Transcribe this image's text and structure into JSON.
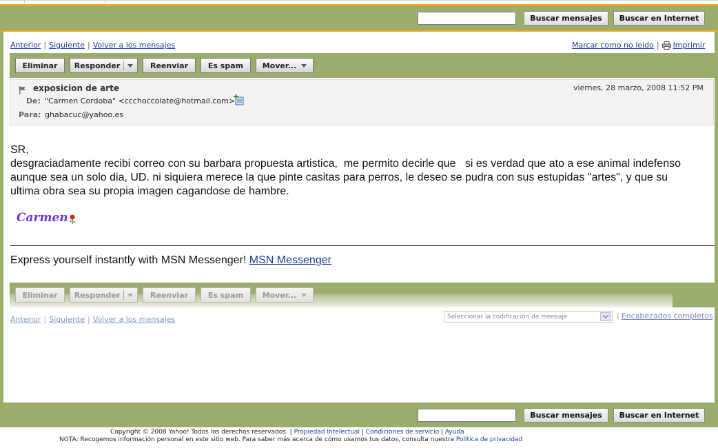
{
  "top_search": {
    "search_messages": "Buscar mensajes",
    "search_web": "Buscar en Internet"
  },
  "nav": {
    "prev": "Anterior",
    "next": "Siguiente",
    "back": "Volver a los mensajes",
    "mark_unread": "Marcar como no leído",
    "print": "Imprimir"
  },
  "toolbar": {
    "delete": "Eliminar",
    "reply": "Responder",
    "forward": "Reenviar",
    "spam": "Es spam",
    "move": "Mover..."
  },
  "message": {
    "subject": "exposicion de arte",
    "date": "viernes, 28 marzo, 2008 11:52 PM",
    "from_label": "De:",
    "from_value": "\"Carmen Cordoba\" <ccchoccolate@hotmail.com>",
    "to_label": "Para:",
    "to_value": "ghabacuc@yahoo.es",
    "greeting": "SR,",
    "line1": "desgraciadamente recibi correo con su barbara propuesta artistica,  me permito decirle que   si es verdad que ato a ese animal indefenso",
    "line2": "aunque sea un solo dia, UD. ni siquiera merece la que pinte casitas para perros, le deseo se pudra con sus estupidas \"artes\", y que su",
    "line3": "ultima obra sea su propia imagen cagandose de hambre.",
    "signature": "Carmen",
    "promo_text": "Express yourself instantly with MSN Messenger! ",
    "promo_link": "MSN Messenger"
  },
  "bottom_nav": {
    "encoding_placeholder": "Seleccionar la codificación de mensaje",
    "headers": "Encabezados",
    "complete": " completos"
  },
  "footer": {
    "copyright": "Copyright © 2008 Yahoo! Todos los derechos reservados. | ",
    "ip": "Propiedad Intelectual",
    "sep1": " | ",
    "terms": "Condiciones de servicio",
    "sep2": " | ",
    "help": "Ayuda",
    "note": "NOTA: Recogemos información personal en este sitio web. Para saber más acerca de cómo usamos tus datos, consulta nuestra ",
    "privacy": "Política de privacidad"
  },
  "colors": {
    "band": "#9aad6c",
    "accent_orange": "#f6a623",
    "link": "#1a3d9a",
    "signature": "#6b35d6"
  }
}
